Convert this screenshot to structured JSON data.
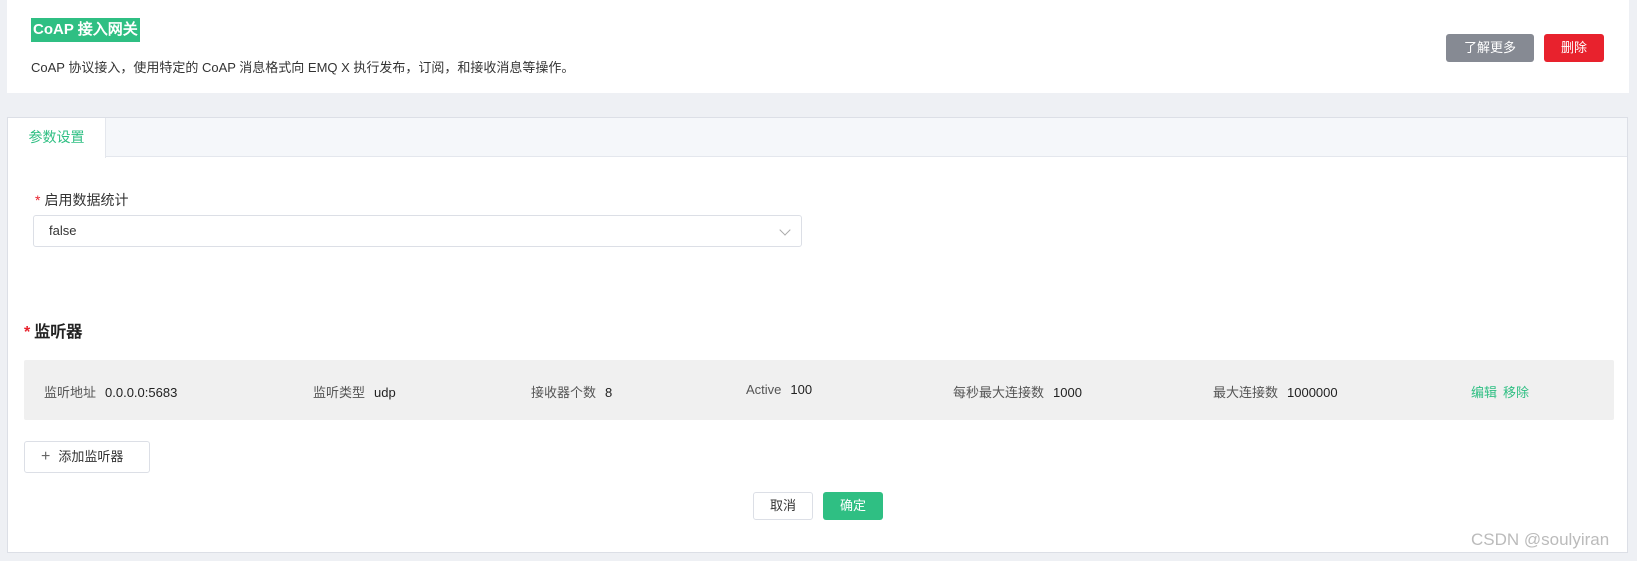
{
  "header": {
    "title": "CoAP 接入网关",
    "description": "CoAP 协议接入，使用特定的 CoAP 消息格式向 EMQ X 执行发布，订阅，和接收消息等操作。",
    "learn_more_label": "了解更多",
    "delete_label": "删除",
    "colors": {
      "accent": "#2fbf83",
      "danger": "#e8222d",
      "neutral": "#868a93"
    }
  },
  "tabs": [
    {
      "label": "参数设置"
    }
  ],
  "form": {
    "stats_label": "启用数据统计",
    "stats_required": "*",
    "stats_value": "false"
  },
  "listeners": {
    "section_label": "监听器",
    "required_mark": "*",
    "rows": [
      {
        "address_label": "监听地址",
        "address": "0.0.0.0:5683",
        "type_label": "监听类型",
        "type": "udp",
        "acceptors_label": "接收器个数",
        "acceptors": "8",
        "active_label": "Active",
        "active": "100",
        "max_rate_label": "每秒最大连接数",
        "max_rate": "1000",
        "max_conn_label": "最大连接数",
        "max_conn": "1000000",
        "edit_label": "编辑",
        "remove_label": "移除"
      }
    ],
    "add_label": "添加监听器"
  },
  "footer": {
    "cancel_label": "取消",
    "confirm_label": "确定"
  },
  "watermark": "CSDN @soulyiran"
}
